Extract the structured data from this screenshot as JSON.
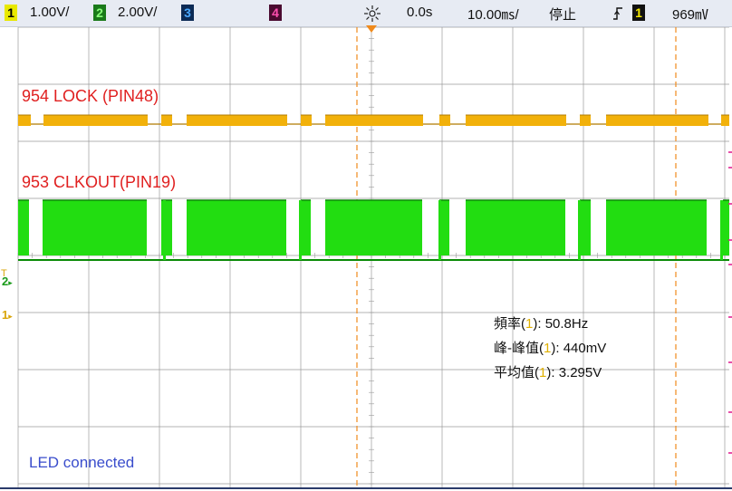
{
  "topbar": {
    "ch1_num": "1",
    "ch1_scale": "1.00V/",
    "ch2_num": "2",
    "ch2_scale": "2.00V/",
    "ch3_num": "3",
    "ch4_num": "4",
    "trigger_icon": "trigger-sun-icon",
    "delay": "0.0s",
    "timebase": "10.00㎳/",
    "run_state": "停止",
    "edge_icon": "rising-edge-icon",
    "trig_source": "1",
    "trig_level": "969㎷"
  },
  "colors": {
    "ch1": "#f2b10a",
    "ch1_dark": "#b07a00",
    "ch2": "#22dd11",
    "ch2_dark": "#0a8a06",
    "ch3": "#1976d2",
    "ch4": "#e1148c",
    "label_red": "#e02020",
    "annotation_blue": "#3a4dcc",
    "grid": "#9a9a9a",
    "marker_orange": "#f08a1c"
  },
  "labels": {
    "trace1": "954 LOCK (PIN48)",
    "trace2": "953 CLKOUT(PIN19)",
    "note": "LED connected"
  },
  "channel_markers": {
    "ch2": "2",
    "ch1": "1"
  },
  "measurements": [
    {
      "label_pre": "頻率(",
      "ch": "1",
      "label_post": "): ",
      "value": "50.8Hz"
    },
    {
      "label_pre": "峰-峰值(",
      "ch": "1",
      "label_post": "): ",
      "value": "440mV"
    },
    {
      "label_pre": "平均值(",
      "ch": "1",
      "label_post": "): ",
      "value": "3.295V"
    }
  ]
}
